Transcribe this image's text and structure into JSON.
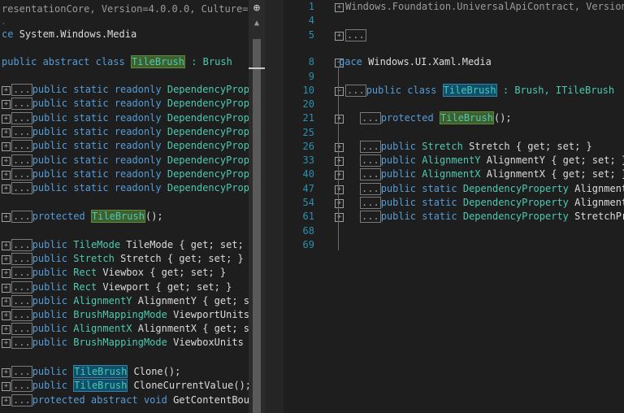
{
  "left": {
    "header": "resentationCore, Version=4.0.0.0, Culture=",
    "namespace_kw": "ce",
    "namespace_name": "System.Windows.Media",
    "class_decl": {
      "kw": "public abstract class",
      "name": "TileBrush",
      "rest": ": Brush"
    },
    "fields": [
      "public static readonly DependencyPrope",
      "public static readonly DependencyPrope",
      "public static readonly DependencyPrope",
      "public static readonly DependencyPrope",
      "public static readonly DependencyPrope",
      "public static readonly DependencyPrope",
      "public static readonly DependencyPrope",
      "public static readonly DependencyPrope"
    ],
    "ctor": {
      "kw": "protected",
      "name": "TileBrush",
      "rest": "();"
    },
    "props": [
      {
        "type": "TileMode",
        "rest": "TileMode { get; set; }"
      },
      {
        "type": "Stretch",
        "rest": "Stretch { get; set; }"
      },
      {
        "type": "Rect",
        "rest": "Viewbox { get; set; }"
      },
      {
        "type": "Rect",
        "rest": "Viewport { get; set; }"
      },
      {
        "type": "AlignmentY",
        "rest": "AlignmentY { get; se"
      },
      {
        "type": "BrushMappingMode",
        "rest": "ViewportUnits"
      },
      {
        "type": "AlignmentX",
        "rest": "AlignmentX { get; se"
      },
      {
        "type": "BrushMappingMode",
        "rest": "ViewboxUnits {"
      }
    ],
    "methods": [
      {
        "kw": "public",
        "type": "TileBrush",
        "rest": "Clone();"
      },
      {
        "kw": "public",
        "type": "TileBrush",
        "rest": "CloneCurrentValue();"
      },
      {
        "kw": "protected abstract void",
        "type": "",
        "rest": "GetContentBoun"
      }
    ],
    "dots": "..."
  },
  "scroll": {
    "button_glyph": "⊕",
    "arrow_glyph": "▲"
  },
  "right": {
    "line_numbers": [
      "1",
      "4",
      "5",
      "8",
      "9",
      "10",
      "20",
      "21",
      "25",
      "26",
      "33",
      "40",
      "47",
      "54",
      "61",
      "68",
      "69"
    ],
    "header": "Windows.Foundation.UniversalApiContract, Version",
    "dots": "...",
    "namespace_kw": "pace",
    "namespace_name": "Windows.UI.Xaml.Media",
    "class_decl": {
      "kw": "public class",
      "name": "TileBrush",
      "rest": ": Brush, ITileBrush"
    },
    "ctor": {
      "kw": "protected",
      "name": "TileBrush",
      "rest": "();"
    },
    "members": [
      {
        "kw": "public",
        "type": "Stretch",
        "rest": "Stretch { get; set; }"
      },
      {
        "kw": "public",
        "type": "AlignmentY",
        "rest": "AlignmentY { get; set; }"
      },
      {
        "kw": "public",
        "type": "AlignmentX",
        "rest": "AlignmentX { get; set; }"
      },
      {
        "kw": "public static",
        "type": "DependencyProperty",
        "rest": "AlignmentX"
      },
      {
        "kw": "public static",
        "type": "DependencyProperty",
        "rest": "AlignmentY"
      },
      {
        "kw": "public static",
        "type": "DependencyProperty",
        "rest": "StretchPro"
      }
    ]
  }
}
